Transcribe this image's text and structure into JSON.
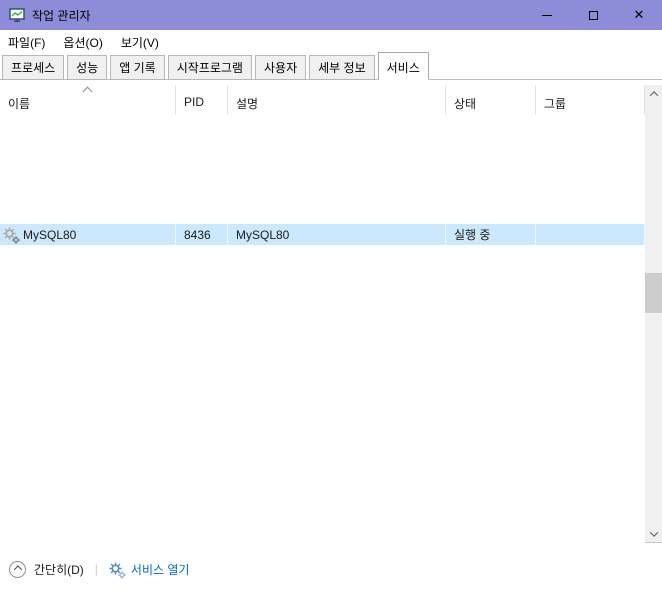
{
  "window": {
    "title": "작업 관리자",
    "controls": {
      "close_glyph": "✕"
    }
  },
  "menu": {
    "items": [
      "파일(F)",
      "옵션(O)",
      "보기(V)"
    ]
  },
  "tabs": {
    "items": [
      "프로세스",
      "성능",
      "앱 기록",
      "시작프로그램",
      "사용자",
      "세부 정보",
      "서비스"
    ],
    "active": "서비스"
  },
  "table": {
    "columns": [
      "이름",
      "PID",
      "설명",
      "상태",
      "그룹"
    ],
    "sort": {
      "column": "이름",
      "direction": "ascending"
    },
    "rows": [
      {
        "name": "MySQL80",
        "pid": "8436",
        "description": "MySQL80",
        "status": "실행 중",
        "group": "",
        "selected": true,
        "icon": "services-gear-icon"
      }
    ]
  },
  "footer": {
    "toggle_label": "간단히(D)",
    "separator": "|",
    "action_label": "서비스 열기",
    "action_icon": "services-gear-icon"
  },
  "colors": {
    "titlebar_bg": "#8d8cd8",
    "selection_bg": "#cce8ff",
    "link": "#0066cc"
  }
}
